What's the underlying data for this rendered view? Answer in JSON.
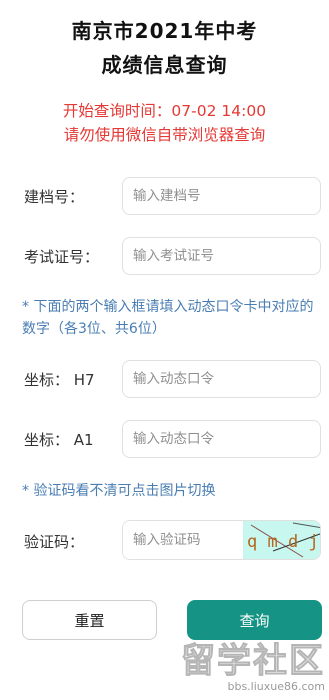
{
  "header": {
    "title_line1": "南京市2021年中考",
    "title_line2": "成绩信息查询"
  },
  "notice": {
    "line1": "开始查询时间：07-02 14:00",
    "line2": "请勿使用微信自带浏览器查询"
  },
  "form": {
    "file_no": {
      "label": "建档号：",
      "placeholder": "输入建档号",
      "value": ""
    },
    "exam_no": {
      "label": "考试证号：",
      "placeholder": "输入考试证号",
      "value": ""
    },
    "token_hint": "* 下面的两个输入框请填入动态口令卡中对应的数字（各3位、共6位）",
    "coord1": {
      "label": "坐标： H7",
      "placeholder": "输入动态口令",
      "value": ""
    },
    "coord2": {
      "label": "坐标： A1",
      "placeholder": "输入动态口令",
      "value": ""
    },
    "captcha_hint": "* 验证码看不清可点击图片切换",
    "captcha": {
      "label": "验证码：",
      "placeholder": "输入验证码",
      "value": "",
      "image_text": "q m d j"
    }
  },
  "actions": {
    "reset_label": "重置",
    "query_label": "查询"
  },
  "watermark": {
    "main": "留学社区",
    "url": "bbs.liuxue86.com"
  },
  "colors": {
    "title": "#111111",
    "notice": "#e53935",
    "hint": "#4a7eb3",
    "primary": "#159485",
    "captcha_bg": "#c7f7ef"
  }
}
